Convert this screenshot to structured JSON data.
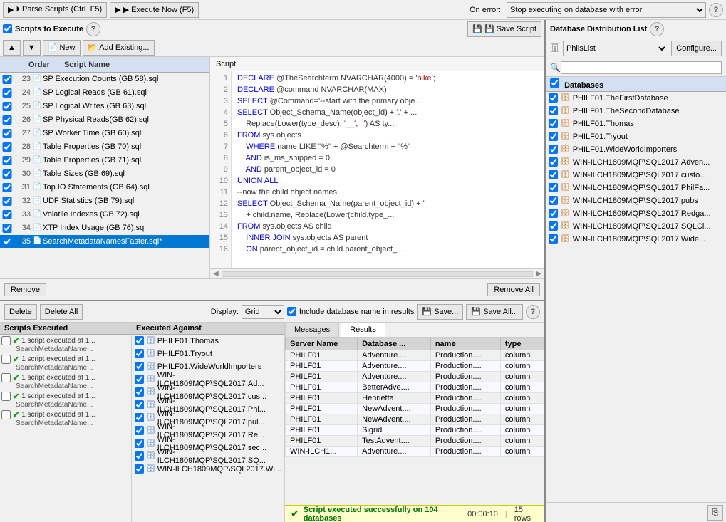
{
  "topToolbar": {
    "parseBtn": "⏵ Parse Scripts (Ctrl+F5)",
    "executeBtn": "▶ Execute Now (F5)",
    "onErrorLabel": "On error:",
    "errorOption": "Stop executing on database with error",
    "helpIcon": "?"
  },
  "scriptsPanel": {
    "title": "Scripts to Execute",
    "newBtn": "New",
    "addExistingBtn": "Add Existing...",
    "saveScriptBtn": "💾 Save Script",
    "columns": [
      "Order",
      "Script Name"
    ],
    "scripts": [
      {
        "order": 23,
        "name": "SP Execution Counts (GB 58).sql",
        "checked": true
      },
      {
        "order": 24,
        "name": "SP Logical Reads (GB 61).sql",
        "checked": true
      },
      {
        "order": 25,
        "name": "SP Logical Writes (GB 63).sql",
        "checked": true
      },
      {
        "order": 26,
        "name": "SP Physical Reads(GB 62).sql",
        "checked": true
      },
      {
        "order": 27,
        "name": "SP Worker Time (GB 60).sql",
        "checked": true
      },
      {
        "order": 28,
        "name": "Table Properties (GB 70).sql",
        "checked": true
      },
      {
        "order": 29,
        "name": "Table Properties (GB 71).sql",
        "checked": true
      },
      {
        "order": 30,
        "name": "Table Sizes (GB 69).sql",
        "checked": true
      },
      {
        "order": 31,
        "name": "Top IO Statements (GB 64).sql",
        "checked": true
      },
      {
        "order": 32,
        "name": "UDF Statistics (GB 79).sql",
        "checked": true
      },
      {
        "order": 33,
        "name": "Volatile Indexes (GB 72).sql",
        "checked": true
      },
      {
        "order": 34,
        "name": "XTP Index Usage (GB 76).sql",
        "checked": true
      },
      {
        "order": 35,
        "name": "SearchMetadataNamesFaster.sql*",
        "checked": true,
        "selected": true
      }
    ],
    "removeBtn": "Remove",
    "removeAllBtn": "Remove All"
  },
  "scriptEditor": {
    "label": "Script",
    "lines": [
      {
        "num": 1,
        "text": "DECLARE @TheSearchterm NVARCHAR(4000) = 'bike';"
      },
      {
        "num": 2,
        "text": "DECLARE @command NVARCHAR(MAX)"
      },
      {
        "num": 3,
        "text": "SELECT @Command='--start with the primary obje..."
      },
      {
        "num": 4,
        "text": "SELECT Object_Schema_Name(object_id) + '.' + ..."
      },
      {
        "num": 5,
        "text": "    Replace(Lower(type_desc), '__', ' ') AS ty..."
      },
      {
        "num": 6,
        "text": "FROM sys.objects"
      },
      {
        "num": 7,
        "text": "    WHERE name LIKE ''%'' + @Searchterm + ''%''"
      },
      {
        "num": 8,
        "text": "    AND is_ms_shipped = 0"
      },
      {
        "num": 9,
        "text": "    AND parent_object_id = 0"
      },
      {
        "num": 10,
        "text": "UNION ALL"
      },
      {
        "num": 11,
        "text": "--now the child object names"
      },
      {
        "num": 12,
        "text": "SELECT Object_Schema_Name(parent_object_id) + '"
      },
      {
        "num": 13,
        "text": "    + child.name, Replace(Lower(child.type_..."
      },
      {
        "num": 14,
        "text": "FROM sys.objects AS child"
      },
      {
        "num": 15,
        "text": "    INNER JOIN sys.objects AS parent"
      },
      {
        "num": 16,
        "text": "    ON parent_object_id = child.parent_object_..."
      }
    ]
  },
  "lowerToolbar": {
    "deleteBtn": "Delete",
    "deleteAllBtn": "Delete All",
    "displayLabel": "Display:",
    "displayOption": "Grid",
    "includeDbLabel": "Include database name in results",
    "saveBtn": "💾 Save...",
    "saveAllBtn": "💾 Save All...",
    "helpIcon": "?"
  },
  "scriptsExecuted": {
    "title": "Scripts Executed",
    "groups": [
      {
        "header": "1 script executed at 1...",
        "sub": "SearchMetadataName..."
      },
      {
        "header": "1 script executed at 1...",
        "sub": "SearchMetadataName..."
      },
      {
        "header": "1 script executed at 1...",
        "sub": "SearchMetadataName..."
      },
      {
        "header": "1 script executed at 1...",
        "sub": "SearchMetadataName..."
      },
      {
        "header": "1 script executed at 1...",
        "sub": "SearchMetadataName..."
      }
    ]
  },
  "executedAgainst": {
    "title": "Executed Against",
    "databases": [
      "PHILF01.Thomas",
      "PHILF01.Tryout",
      "PHILF01.WideWorldImporters",
      "WIN-ILCH1809MQP\\SQL2017.Ad...",
      "WIN-ILCH1809MQP\\SQL2017.cus...",
      "WIN-ILCH1809MQP\\SQL2017.Phi...",
      "WIN-ILCH1809MQP\\SQL2017.pul...",
      "WIN-ILCH1809MQP\\SQL2017.Re...",
      "WIN-ILCH1809MQP\\SQL2017.sec...",
      "WIN-ILCH1809MQP\\SQL2017.SQ...",
      "WIN-ILCH1809MQP\\SQL2017.Wi..."
    ]
  },
  "results": {
    "tabs": [
      "Messages",
      "Results"
    ],
    "activeTab": "Results",
    "columns": [
      "Server Name",
      "Database ...",
      "name",
      "type"
    ],
    "rows": [
      [
        "PHILF01",
        "Adventure....",
        "Production....",
        "column"
      ],
      [
        "PHILF01",
        "Adventure....",
        "Production....",
        "column"
      ],
      [
        "PHILF01",
        "Adventure....",
        "Production....",
        "column"
      ],
      [
        "PHILF01",
        "BetterAdve....",
        "Production....",
        "column"
      ],
      [
        "PHILF01",
        "Henrietta",
        "Production....",
        "column"
      ],
      [
        "PHILF01",
        "NewAdvent....",
        "Production....",
        "column"
      ],
      [
        "PHILF01",
        "NewAdvent....",
        "Production....",
        "column"
      ],
      [
        "PHILF01",
        "Sigrid",
        "Production....",
        "column"
      ],
      [
        "PHILF01",
        "TestAdvent....",
        "Production....",
        "column"
      ],
      [
        "WIN-ILCH1...",
        "Adventure....",
        "Production....",
        "column"
      ]
    ]
  },
  "statusBar": {
    "icon": "✔",
    "message": "Script executed successfully on 104 databases",
    "time": "00:00:10",
    "rows": "15 rows"
  },
  "dbPanel": {
    "title": "Database Distribution List",
    "helpIcon": "?",
    "selectedList": "PhilsList",
    "configureBtn": "Configure...",
    "searchPlaceholder": "",
    "dbHeaderLabel": "Databases",
    "databases": [
      "PHILF01.TheFirstDatabase",
      "PHILF01.TheSecondDatabase",
      "PHILF01.Thomas",
      "PHILF01.Tryout",
      "PHILF01.WideWorldImporters",
      "WIN-ILCH1809MQP\\SQL2017.Adven...",
      "WIN-ILCH1809MQP\\SQL2017.custo...",
      "WIN-ILCH1809MQP\\SQL2017.PhilFa...",
      "WIN-ILCH1809MQP\\SQL2017.pubs",
      "WIN-ILCH1809MQP\\SQL2017.Redga...",
      "WIN-ILCH1809MQP\\SQL2017.SQLCl...",
      "WIN-ILCH1809MQP\\SQL2017.Wide..."
    ]
  }
}
